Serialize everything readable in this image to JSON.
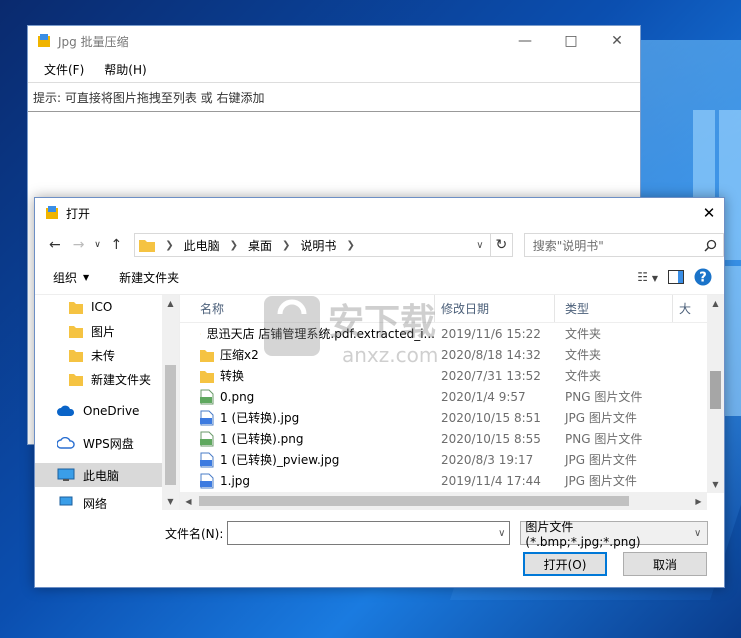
{
  "app": {
    "title": "Jpg 批量压缩",
    "menu": [
      {
        "label": "文件(F)"
      },
      {
        "label": "帮助(H)"
      }
    ],
    "hint": "提示: 可直接将图片拖拽至列表 或 右键添加"
  },
  "dialog": {
    "title": "打开",
    "breadcrumb": [
      {
        "label": "此电脑"
      },
      {
        "label": "桌面"
      },
      {
        "label": "说明书"
      }
    ],
    "search_placeholder": "搜索\"说明书\"",
    "toolbar": {
      "organize": "组织",
      "new_folder": "新建文件夹"
    },
    "nav_items": [
      {
        "label": "ICO",
        "icon": "folder-icon"
      },
      {
        "label": "图片",
        "icon": "folder-icon"
      },
      {
        "label": "未传",
        "icon": "folder-icon"
      },
      {
        "label": "新建文件夹",
        "icon": "folder-icon"
      },
      {
        "label": "OneDrive",
        "icon": "cloud-icon"
      },
      {
        "label": "WPS网盘",
        "icon": "cloud-outline-icon"
      },
      {
        "label": "此电脑",
        "icon": "pc-icon"
      },
      {
        "label": "网络",
        "icon": "network-icon"
      }
    ],
    "columns": {
      "name": "名称",
      "date": "修改日期",
      "type": "类型",
      "size": "大"
    },
    "files": [
      {
        "name": "思迅天店 店铺管理系统.pdf.extracted_i...",
        "date": "2019/11/6 15:22",
        "type": "文件夹",
        "icon": "folder"
      },
      {
        "name": "压缩x2",
        "date": "2020/8/18 14:32",
        "type": "文件夹",
        "icon": "folder"
      },
      {
        "name": "转换",
        "date": "2020/7/31 13:52",
        "type": "文件夹",
        "icon": "folder"
      },
      {
        "name": "0.png",
        "date": "2020/1/4 9:57",
        "type": "PNG 图片文件",
        "icon": "png"
      },
      {
        "name": "1 (已转换).jpg",
        "date": "2020/10/15 8:51",
        "type": "JPG 图片文件",
        "icon": "jpg"
      },
      {
        "name": "1 (已转换).png",
        "date": "2020/10/15 8:55",
        "type": "PNG 图片文件",
        "icon": "png"
      },
      {
        "name": "1 (已转换)_pview.jpg",
        "date": "2020/8/3 19:17",
        "type": "JPG 图片文件",
        "icon": "jpg"
      },
      {
        "name": "1.jpg",
        "date": "2019/11/4 17:44",
        "type": "JPG 图片文件",
        "icon": "jpg"
      }
    ],
    "filename_label": "文件名(N):",
    "filename_value": "",
    "filetype": "图片文件 (*.bmp;*.jpg;*.png)",
    "open_button": "打开(O)",
    "cancel_button": "取消"
  },
  "watermark": {
    "text": "安下载",
    "sub": "anxz.com"
  },
  "colors": {
    "accent": "#0078d7",
    "folder": "#f5c342",
    "desktop": "#0b4fb0"
  }
}
